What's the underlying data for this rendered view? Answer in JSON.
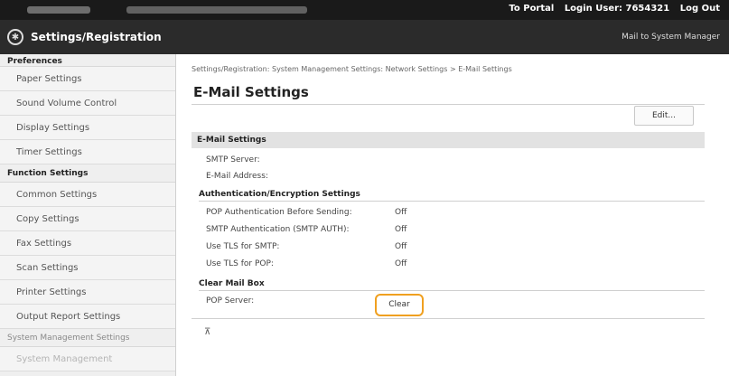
{
  "topbar": {
    "portal_link": "To Portal",
    "login_user": "Login User: 7654321",
    "logout": "Log Out"
  },
  "header": {
    "logo_icon": "home-gear-icon",
    "title": "Settings/Registration",
    "mail_link": "Mail to System Manager"
  },
  "sidebar": {
    "preferences_label": "Preferences",
    "preferences_items": [
      "Paper Settings",
      "Sound Volume Control",
      "Display Settings",
      "Timer Settings"
    ],
    "function_label": "Function Settings",
    "function_items": [
      "Common Settings",
      "Copy Settings",
      "Fax Settings",
      "Scan Settings",
      "Printer Settings",
      "Output Report Settings"
    ],
    "system_label": "System Management Settings",
    "system_items": [
      "System Management"
    ]
  },
  "main": {
    "breadcrumb": "Settings/Registration: System Management Settings: Network Settings > E-Mail Settings",
    "title": "E-Mail Settings",
    "edit_button": "Edit...",
    "section_title": "E-Mail Settings",
    "smtp_server_label": "SMTP Server:",
    "email_address_label": "E-Mail Address:",
    "auth_heading": "Authentication/Encryption Settings",
    "auth_rows": [
      {
        "label": "POP Authentication Before Sending:",
        "value": "Off"
      },
      {
        "label": "SMTP Authentication (SMTP AUTH):",
        "value": "Off"
      },
      {
        "label": "Use TLS for SMTP:",
        "value": "Off"
      },
      {
        "label": "Use TLS for POP:",
        "value": "Off"
      }
    ],
    "clear_heading": "Clear Mail Box",
    "pop_server_label": "POP Server:",
    "clear_button": "Clear",
    "top_icon": "back-to-top-icon"
  },
  "colors": {
    "topbar_bg": "#1a1a1a",
    "header_bg": "#2b2b2b",
    "highlight": "#f0a020"
  }
}
